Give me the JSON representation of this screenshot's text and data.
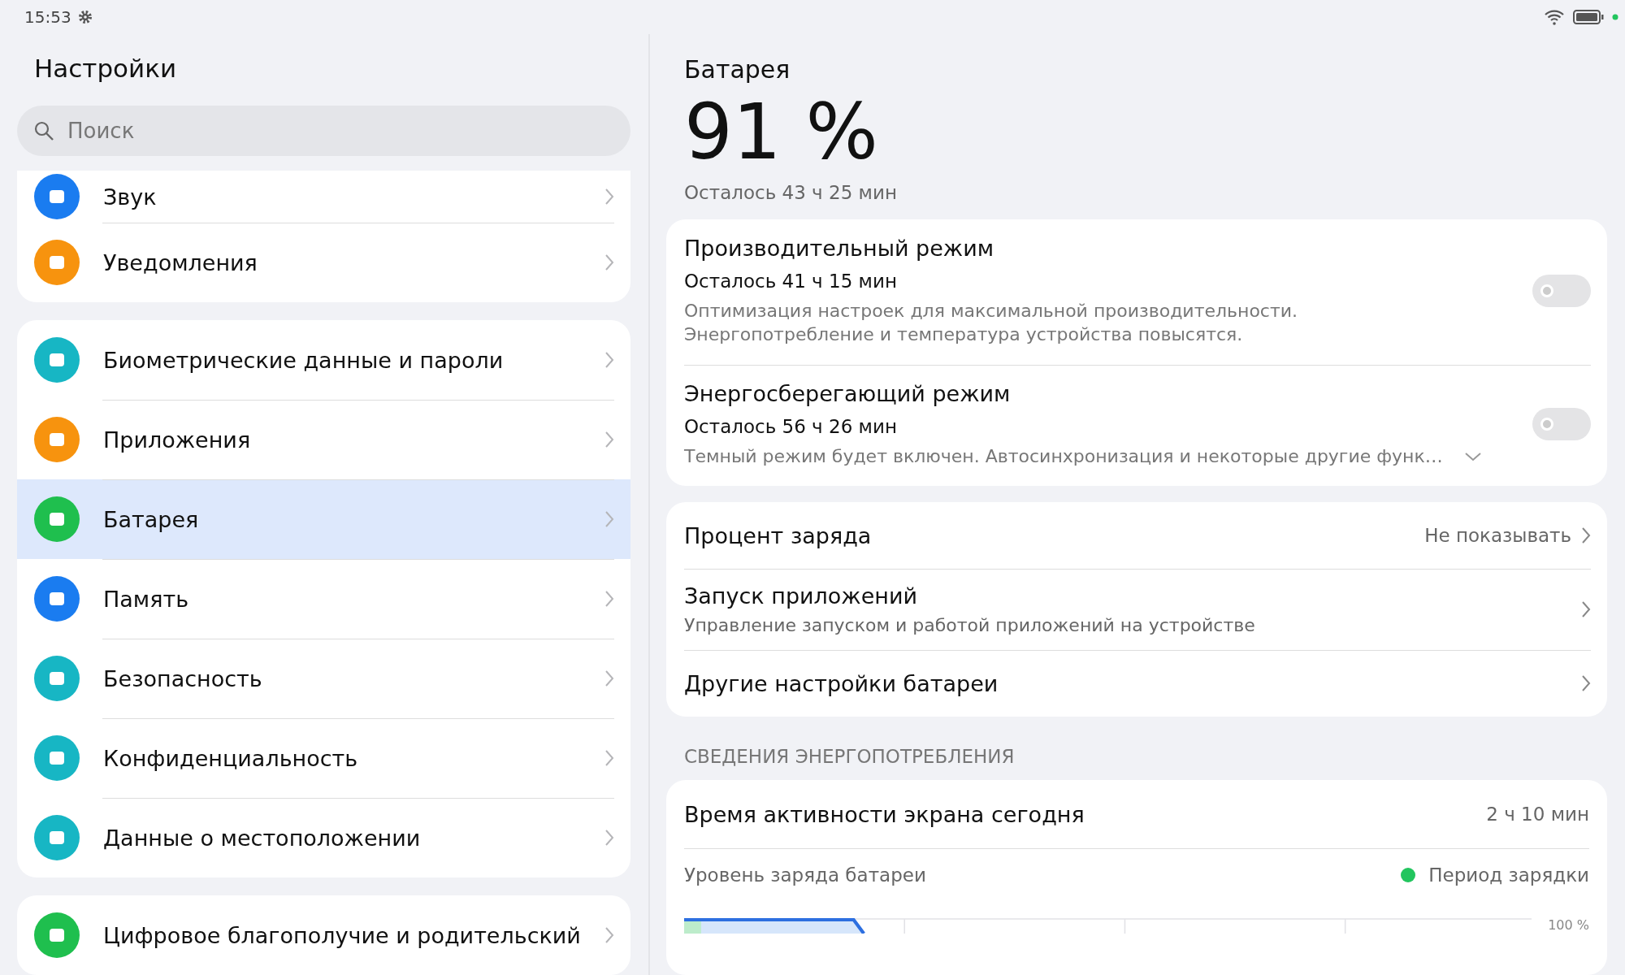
{
  "status_bar": {
    "time": "15:53"
  },
  "sidebar": {
    "title": "Настройки",
    "search": {
      "placeholder": "Поиск"
    },
    "groups": [
      {
        "items": [
          {
            "label": "Звук",
            "color": "#1a7cf0",
            "selected": false
          },
          {
            "label": "Уведомления",
            "color": "#f7930e",
            "selected": false
          }
        ]
      },
      {
        "items": [
          {
            "label": "Биометрические данные и пароли",
            "color": "#17b6c4",
            "selected": false
          },
          {
            "label": "Приложения",
            "color": "#f7930e",
            "selected": false
          },
          {
            "label": "Батарея",
            "color": "#1fbf4e",
            "selected": true
          },
          {
            "label": "Память",
            "color": "#1a7cf0",
            "selected": false
          },
          {
            "label": "Безопасность",
            "color": "#17b6c4",
            "selected": false
          },
          {
            "label": "Конфиденциальность",
            "color": "#17b6c4",
            "selected": false
          },
          {
            "label": "Данные о местоположении",
            "color": "#17b6c4",
            "selected": false
          }
        ]
      },
      {
        "items": [
          {
            "label": "Цифровое благополучие и родительский",
            "color": "#1fbf4e",
            "selected": false
          }
        ]
      }
    ]
  },
  "detail": {
    "title": "Батарея",
    "percent": "91 %",
    "remaining": "Осталось 43 ч 25 мин",
    "modes": [
      {
        "title": "Производительный режим",
        "remaining": "Осталось 41 ч 15 мин",
        "description": "Оптимизация настроек для максимальной производительности.\nЭнергопотребление и температура устройства повысятся.",
        "on": false,
        "expandable": false
      },
      {
        "title": "Энергосберегающий режим",
        "remaining": "Осталось 56 ч 26 мин",
        "description": "Темный режим будет включен. Автосинхронизация и некоторые другие функ…",
        "on": false,
        "expandable": true
      }
    ],
    "settings": [
      {
        "title": "Процент заряда",
        "value": "Не показывать"
      },
      {
        "title": "Запуск приложений",
        "subtitle": "Управление запуском и работой приложений на устройстве"
      },
      {
        "title": "Другие настройки батареи"
      }
    ],
    "section_header": "СВЕДЕНИЯ ЭНЕРГОПОТРЕБЛЕНИЯ",
    "usage": {
      "title": "Время активности экрана сегодня",
      "value": "2 ч 10 мин",
      "chart_title": "Уровень заряда батареи",
      "legend": [
        {
          "label": "Период зарядки",
          "color": "#22c55e"
        }
      ],
      "axis_label": "100 %"
    }
  }
}
